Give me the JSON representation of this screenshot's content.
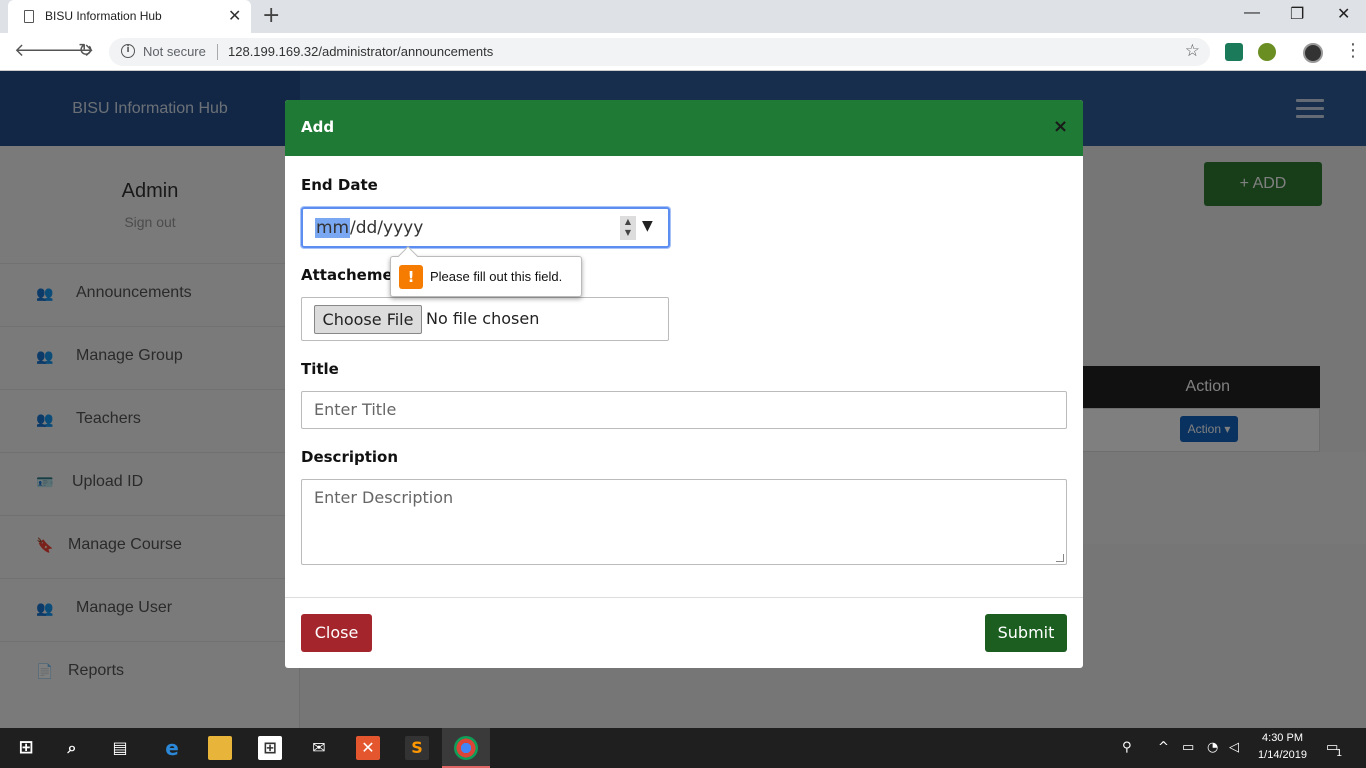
{
  "browser": {
    "tab_title": "BISU Information Hub",
    "tab_close": "✕",
    "new_tab": "+",
    "security_label": "Not secure",
    "url": "128.199.169.32/administrator/announcements",
    "win_minimize": "—",
    "win_restore": "❐",
    "win_close": "✕"
  },
  "app": {
    "brand": "BISU Information Hub",
    "admin_name": "Admin",
    "sign_out": "Sign out",
    "add_button": "+ ADD",
    "table_action_header": "Action",
    "row_action_button": "Action ▾"
  },
  "sidebar": {
    "items": [
      {
        "label": "Announcements",
        "icon": "users-icon",
        "glyph": "👥"
      },
      {
        "label": "Manage Group",
        "icon": "users-icon",
        "glyph": "👥"
      },
      {
        "label": "Teachers",
        "icon": "users-icon",
        "glyph": "👥"
      },
      {
        "label": "Upload ID",
        "icon": "id-card-icon",
        "glyph": "🪪"
      },
      {
        "label": "Manage Course",
        "icon": "bookmark-icon",
        "glyph": "🔖"
      },
      {
        "label": "Manage User",
        "icon": "users-icon",
        "glyph": "👥"
      },
      {
        "label": "Reports",
        "icon": "file-icon",
        "glyph": "📄"
      }
    ]
  },
  "modal": {
    "title": "Add",
    "close_x": "×",
    "end_date_label": "End Date",
    "date_mm": "mm",
    "date_rest": "/dd/yyyy",
    "attachment_label": "Attacheme",
    "validation_message": "Please fill out this field.",
    "choose_file": "Choose File",
    "no_file": "No file chosen",
    "title_label": "Title",
    "title_placeholder": "Enter Title",
    "description_label": "Description",
    "description_placeholder": "Enter Description",
    "close_button": "Close",
    "submit_button": "Submit"
  },
  "taskbar": {
    "time": "4:30 PM",
    "date": "1/14/2019",
    "notification_count": "1"
  },
  "colors": {
    "modal_header": "#1f7a35",
    "close_button": "#a4262c",
    "submit_button": "#1b5e20",
    "app_header": "#2f5c9a",
    "warning": "#f57c00"
  }
}
